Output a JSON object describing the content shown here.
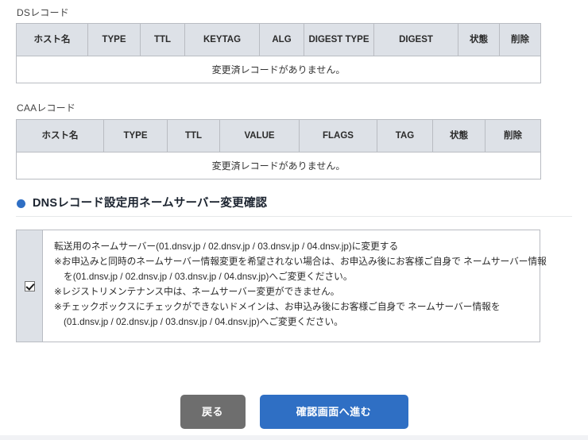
{
  "ds_section": {
    "label": "DSレコード",
    "columns": [
      "ホスト名",
      "TYPE",
      "TTL",
      "KEYTAG",
      "ALG",
      "DIGEST TYPE",
      "DIGEST",
      "状態",
      "削除"
    ],
    "empty_message": "変更済レコードがありません。"
  },
  "caa_section": {
    "label": "CAAレコード",
    "columns": [
      "ホスト名",
      "TYPE",
      "TTL",
      "VALUE",
      "FLAGS",
      "TAG",
      "状態",
      "削除"
    ],
    "empty_message": "変更済レコードがありません。"
  },
  "nameserver_section": {
    "heading": "DNSレコード設定用ネームサーバー変更確認",
    "checkbox_checked": true,
    "notice_lines": [
      {
        "text": "転送用のネームサーバー(01.dnsv.jp / 02.dnsv.jp / 03.dnsv.jp / 04.dnsv.jp)に変更する",
        "indent": false
      },
      {
        "text": "※お申込みと同時のネームサーバー情報変更を希望されない場合は、お申込み後にお客様ご自身で ネームサーバー情報",
        "indent": false
      },
      {
        "text": "を(01.dnsv.jp / 02.dnsv.jp / 03.dnsv.jp / 04.dnsv.jp)へご変更ください。",
        "indent": true
      },
      {
        "text": "※レジストリメンテナンス中は、ネームサーバー変更ができません。",
        "indent": false
      },
      {
        "text": "※チェックボックスにチェックができないドメインは、お申込み後にお客様ご自身で ネームサーバー情報を",
        "indent": false
      },
      {
        "text": "(01.dnsv.jp / 02.dnsv.jp / 03.dnsv.jp / 04.dnsv.jp)へご変更ください。",
        "indent": true
      }
    ]
  },
  "actions": {
    "back_label": "戻る",
    "next_label": "確認画面へ進む"
  },
  "colors": {
    "accent_blue": "#2f6fc4",
    "button_gray": "#6e6e6e",
    "table_header_bg": "#dde1e7",
    "border": "#b9bcc2"
  }
}
